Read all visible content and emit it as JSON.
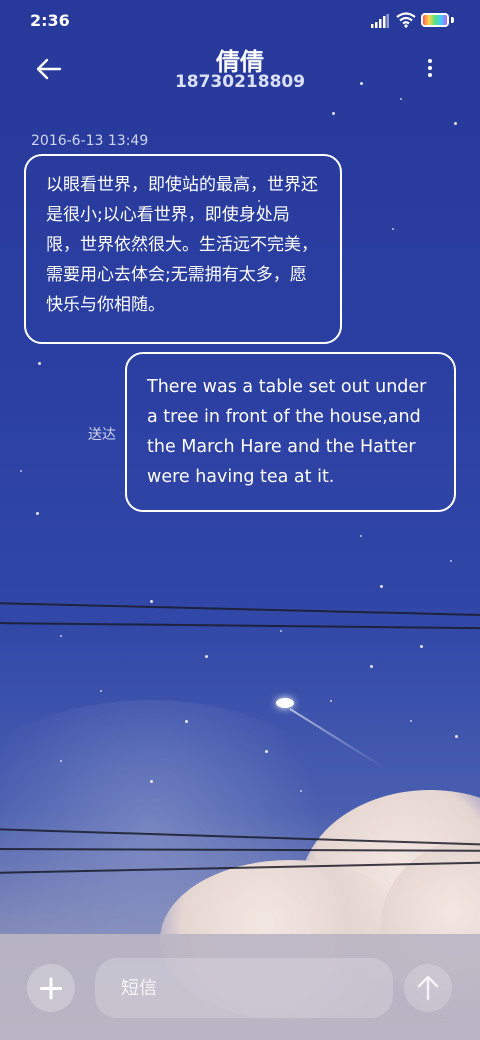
{
  "status_bar": {
    "time": "2:36",
    "icons": [
      "signal-icon",
      "wifi-icon",
      "battery-icon"
    ]
  },
  "header": {
    "contact_name": "倩倩",
    "phone_number": "18730218809",
    "back_icon": "arrow-left-icon",
    "menu_icon": "more-vertical-icon"
  },
  "messages": [
    {
      "direction": "incoming",
      "timestamp": "2016-6-13 13:49",
      "text": "以眼看世界，即使站的最高，世界还是很小;以心看世界，即使身处局限，世界依然很大。生活远不完美，需要用心去体会;无需拥有太多，愿快乐与你相随。"
    },
    {
      "direction": "outgoing",
      "status": "送达",
      "text": "There was a table set out under a tree in front of the house,and the March Hare and the Hatter were having tea at it."
    }
  ],
  "composer": {
    "placeholder": "短信",
    "add_icon": "plus-icon",
    "send_icon": "arrow-up-icon"
  },
  "colors": {
    "bubble_border": "#ffffff",
    "sky_top": "#27399a",
    "composer_bg": "#bab6c4"
  }
}
